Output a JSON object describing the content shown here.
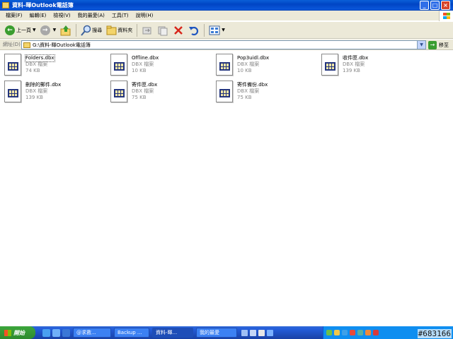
{
  "window": {
    "title": "資料-暉Outlook電話簿",
    "controls": {
      "minimize": "_",
      "maximize": "□",
      "close": "×"
    }
  },
  "menubar": {
    "items": [
      "檔案(F)",
      "編輯(E)",
      "檢視(V)",
      "我的最愛(A)",
      "工具(T)",
      "說明(H)"
    ]
  },
  "toolbar": {
    "back_label": "上一頁",
    "search_label": "搜尋",
    "folders_label": "資料夾"
  },
  "addressbar": {
    "label": "網址(D)",
    "path": "G:\\資料-暉Outlook電話簿",
    "go_label": "移至"
  },
  "files": [
    {
      "name": "Folders.dbx",
      "type": "DBX 檔案",
      "size": "74 KB",
      "selected": true
    },
    {
      "name": "Offline.dbx",
      "type": "DBX 檔案",
      "size": "10 KB"
    },
    {
      "name": "Pop3uidl.dbx",
      "type": "DBX 檔案",
      "size": "10 KB"
    },
    {
      "name": "收件匣.dbx",
      "type": "DBX 檔案",
      "size": "139 KB"
    },
    {
      "name": "刪除的郵件.dbx",
      "type": "DBX 檔案",
      "size": "139 KB"
    },
    {
      "name": "寄件匣.dbx",
      "type": "DBX 檔案",
      "size": "75 KB"
    },
    {
      "name": "寄件備份.dbx",
      "type": "DBX 檔案",
      "size": "75 KB"
    }
  ],
  "taskbar": {
    "start_label": "開始",
    "tasks": [
      "@求救...",
      "Backup ...",
      "資料-暉...",
      "我的最愛"
    ],
    "watermark": "#683166"
  },
  "colors": {
    "titlebar": "#0a5fd8",
    "chrome": "#ece9d8",
    "taskbar": "#245edb",
    "start": "#3ca63c"
  }
}
